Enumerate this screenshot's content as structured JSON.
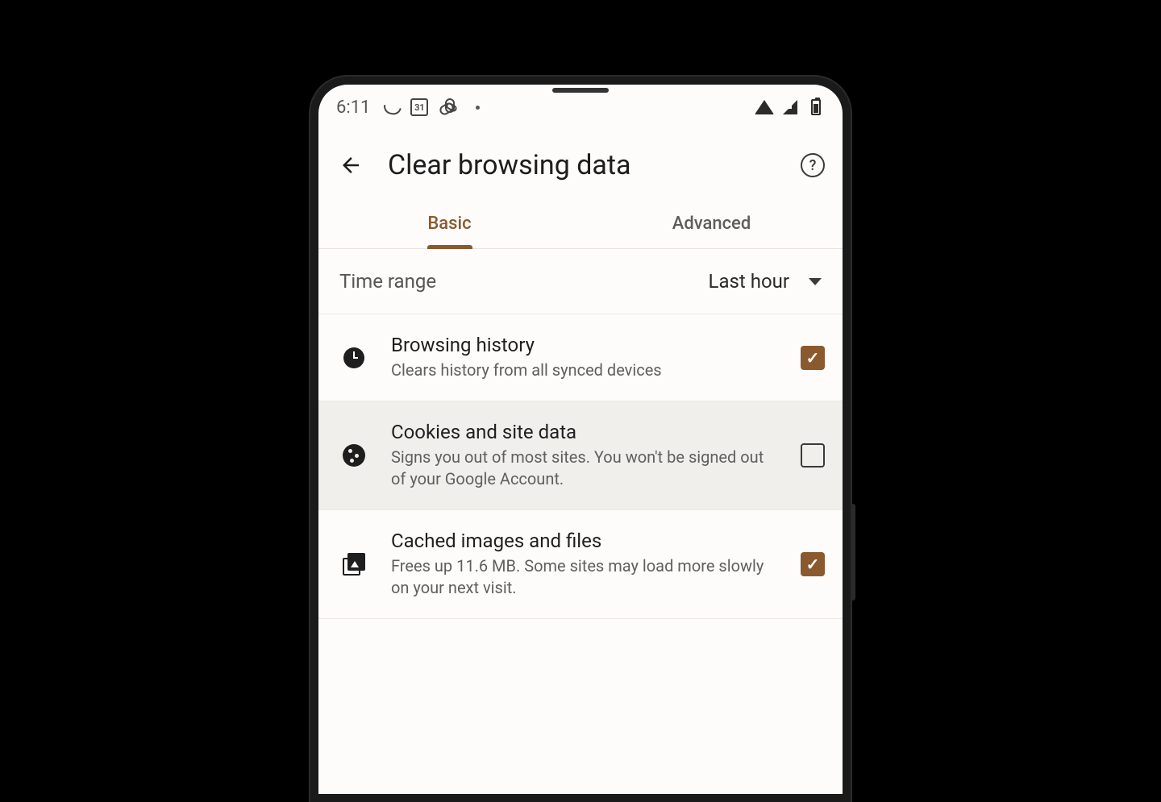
{
  "status": {
    "time": "6:11",
    "calendar_day": "31"
  },
  "header": {
    "title": "Clear browsing data",
    "help_char": "?"
  },
  "tabs": {
    "basic": "Basic",
    "advanced": "Advanced"
  },
  "time_range": {
    "label": "Time range",
    "value": "Last hour"
  },
  "rows": {
    "history": {
      "title": "Browsing history",
      "desc": "Clears history from all synced devices"
    },
    "cookies": {
      "title": "Cookies and site data",
      "desc": "Signs you out of most sites. You won't be signed out of your Google Account."
    },
    "cache": {
      "title": "Cached images and files",
      "desc": "Frees up 11.6 MB. Some sites may load more slowly on your next visit."
    }
  },
  "colors": {
    "accent": "#8a5a2e"
  }
}
